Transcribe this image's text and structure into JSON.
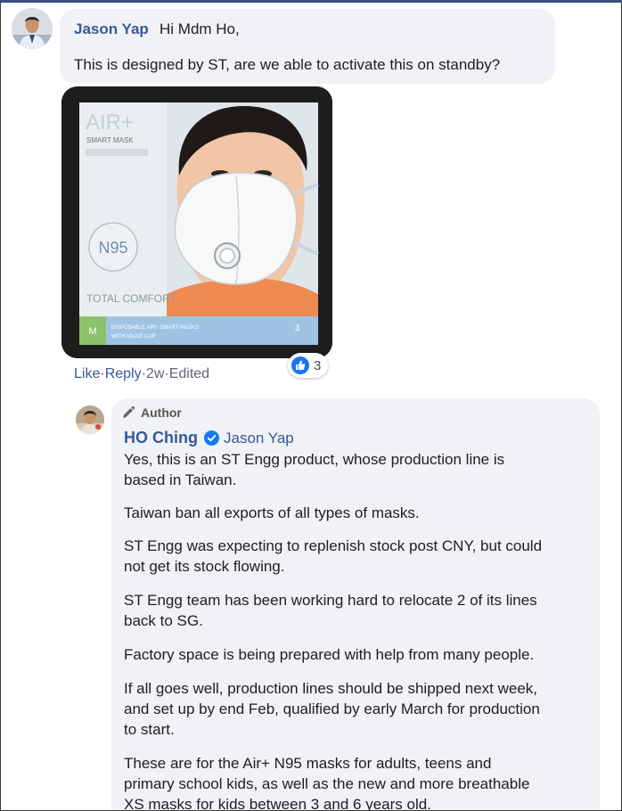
{
  "comment": {
    "author": "Jason Yap",
    "greeting": "Hi Mdm Ho,",
    "text": "This is designed by ST, are we able to activate this on standby?",
    "image": {
      "brand_text": "AIR+",
      "brand_sub": "SMART MASK",
      "rating": "N95",
      "tagline": "TOTAL COMFORT",
      "size_label": "M",
      "product_line": "DISPOSABLE AIR+ SMART MASKS WITH VALVE CAP",
      "pack_count": "3"
    },
    "actions": {
      "like": "Like",
      "sep1": " · ",
      "reply": "Reply",
      "sep2": " · ",
      "time": "2w",
      "sep3": " · ",
      "edited": "Edited"
    },
    "reaction_count": "3"
  },
  "reply": {
    "badge": "Author",
    "author": "HO Ching",
    "tagged": "Jason Yap",
    "paragraphs": [
      "Yes, this is an ST Engg product, whose production line is\nbased in Taiwan.",
      "Taiwan ban all exports of all types of masks.",
      "ST Engg was expecting to replenish stock post CNY, but could\nnot get its stock flowing.",
      "ST Engg team has been working hard to relocate 2 of its lines\nback to SG.",
      "Factory space is being prepared with help from many people.",
      "If all goes well, production lines should be shipped next week,\nand set up by end Feb, qualified by early March for production\nto start.",
      "These are for the Air+ N95 masks for adults, teens and\nprimary school kids, as well as the new and more breathable\nXS masks for kids between 3 and 6 years old."
    ]
  },
  "colors": {
    "link": "#385898",
    "bubble": "#f0f2f5",
    "like_blue": "#1877f2"
  }
}
